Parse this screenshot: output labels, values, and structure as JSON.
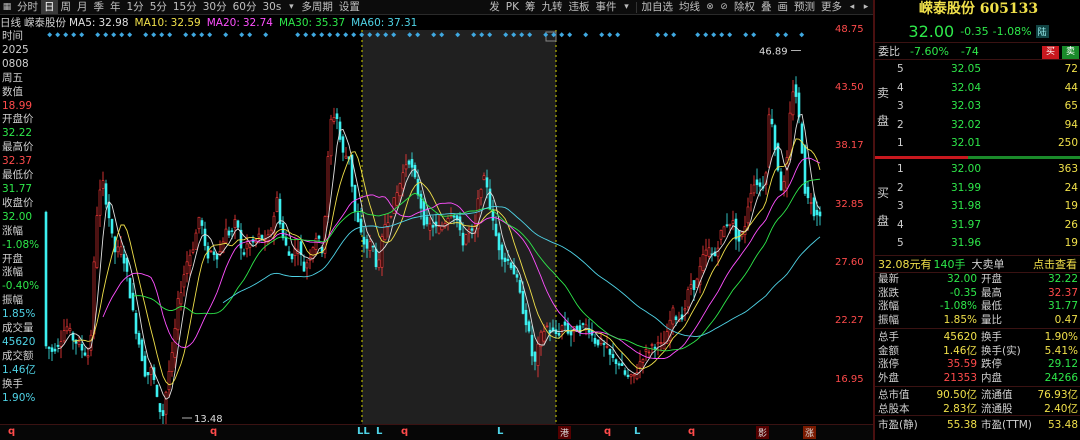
{
  "toolbar": {
    "left_items": [
      "分时",
      "日",
      "周",
      "月",
      "季",
      "年",
      "1分",
      "5分",
      "15分",
      "30分",
      "60分",
      "30s",
      "多周期",
      "设置"
    ],
    "active": "日",
    "right_items": [
      "发",
      "PK",
      "筹",
      "九转",
      "违板",
      "事件",
      "加自选",
      "均线",
      "除权",
      "叠",
      "画",
      "预测",
      "更多"
    ]
  },
  "ma_line": {
    "period": "日线",
    "stock": "嵘泰股份",
    "ma5": {
      "label": "MA5:",
      "value": "32.98",
      "color": "#e0e0e0"
    },
    "ma10": {
      "label": "MA10:",
      "value": "32.59",
      "color": "#f0e04a"
    },
    "ma20": {
      "label": "MA20:",
      "value": "32.74",
      "color": "#ff50ff"
    },
    "ma30": {
      "label": "MA30:",
      "value": "35.37",
      "color": "#2ee84a"
    },
    "ma60": {
      "label": "MA60:",
      "value": "37.31",
      "color": "#4fd3e6"
    }
  },
  "info": {
    "time_label": "时间",
    "year": "2025",
    "date": "0808",
    "weekday": "周五",
    "value_label": "数值",
    "value": "18.99",
    "open_label": "开盘价",
    "open": "32.22",
    "high_label": "最高价",
    "high": "32.37",
    "low_label": "最低价",
    "low": "31.77",
    "close_label": "收盘价",
    "close": "32.00",
    "chg_label": "涨幅",
    "chg": "-1.08%",
    "open_chg_label1": "开盘",
    "open_chg_label2": "涨幅",
    "open_chg": "-0.40%",
    "amp_label": "振幅",
    "amp": "1.85%",
    "vol_label": "成交量",
    "vol": "45620",
    "amt_label": "成交额",
    "amt": "1.46亿",
    "turn_label": "换手",
    "turn": "1.90%"
  },
  "axis": {
    "ticks": [
      "48.75",
      "43.50",
      "38.17",
      "32.85",
      "27.60",
      "22.27",
      "16.95"
    ],
    "high_marker": "46.89",
    "low_marker": "13.48"
  },
  "bottom_markers": {
    "q": "q",
    "l": "L",
    "b1": "LL",
    "hk": "港",
    "ying": "影",
    "zhang": "涨"
  },
  "panel": {
    "title": "嵘泰股份 605133",
    "price": "32.00",
    "change": "-0.35",
    "pct": "-1.08%",
    "tag": "陆",
    "wb_label": "委比",
    "wb_pct": "-7.60%",
    "wb_val": "-74",
    "buy_btn": "买",
    "sell_btn": "卖",
    "sell_label": [
      "卖",
      "盘"
    ],
    "buy_label": [
      "买",
      "盘"
    ],
    "asks": [
      {
        "level": "5",
        "price": "32.05",
        "vol": "72"
      },
      {
        "level": "4",
        "price": "32.04",
        "vol": "44"
      },
      {
        "level": "3",
        "price": "32.03",
        "vol": "65"
      },
      {
        "level": "2",
        "price": "32.02",
        "vol": "94"
      },
      {
        "level": "1",
        "price": "32.01",
        "vol": "250"
      }
    ],
    "bids": [
      {
        "level": "1",
        "price": "32.00",
        "vol": "363"
      },
      {
        "level": "2",
        "price": "31.99",
        "vol": "24"
      },
      {
        "level": "3",
        "price": "31.98",
        "vol": "19"
      },
      {
        "level": "4",
        "price": "31.97",
        "vol": "26"
      },
      {
        "level": "5",
        "price": "31.96",
        "vol": "19"
      }
    ],
    "big_order": {
      "price": "32.08元有",
      "qty": "140手",
      "label": "大卖单",
      "link": "点击查看"
    },
    "stats": [
      {
        "k1": "最新",
        "v1": "32.00",
        "c1": "#2ee84a",
        "k2": "开盘",
        "v2": "32.22",
        "c2": "#2ee84a"
      },
      {
        "k1": "涨跌",
        "v1": "-0.35",
        "c1": "#2ee84a",
        "k2": "最高",
        "v2": "32.37",
        "c2": "#ff4b4b"
      },
      {
        "k1": "涨幅",
        "v1": "-1.08%",
        "c1": "#2ee84a",
        "k2": "最低",
        "v2": "31.77",
        "c2": "#2ee84a"
      },
      {
        "k1": "振幅",
        "v1": "1.85%",
        "c1": "#f0e04a",
        "k2": "量比",
        "v2": "0.47",
        "c2": "#f0e04a"
      },
      {
        "k1": "总手",
        "v1": "45620",
        "c1": "#f0e04a",
        "k2": "换手",
        "v2": "1.90%",
        "c2": "#f0e04a"
      },
      {
        "k1": "金额",
        "v1": "1.46亿",
        "c1": "#f0e04a",
        "k2": "换手(实)",
        "v2": "5.41%",
        "c2": "#f0e04a"
      },
      {
        "k1": "涨停",
        "v1": "35.59",
        "c1": "#ff4b4b",
        "k2": "跌停",
        "v2": "29.12",
        "c2": "#2ee84a"
      },
      {
        "k1": "外盘",
        "v1": "21353",
        "c1": "#ff4b4b",
        "k2": "内盘",
        "v2": "24266",
        "c2": "#2ee84a"
      },
      {
        "k1": "总市值",
        "v1": "90.50亿",
        "c1": "#f0e04a",
        "k2": "流通值",
        "v2": "76.93亿",
        "c2": "#f0e04a"
      },
      {
        "k1": "总股本",
        "v1": "2.83亿",
        "c1": "#f0e04a",
        "k2": "流通股",
        "v2": "2.40亿",
        "c2": "#f0e04a"
      },
      {
        "k1": "市盈(静)",
        "v1": "55.38",
        "c1": "#f0e04a",
        "k2": "市盈(TTM)",
        "v2": "53.48",
        "c2": "#f0e04a"
      }
    ]
  },
  "chart_data": {
    "type": "candlestick",
    "ylim": [
      13.48,
      48.75
    ],
    "y_ticks": [
      48.75,
      43.5,
      38.17,
      32.85,
      27.6,
      22.27,
      16.95
    ],
    "trend": [
      [
        0,
        20.1
      ],
      [
        8,
        19.6
      ],
      [
        15,
        20.4
      ],
      [
        22,
        21.9
      ],
      [
        28,
        20.8
      ],
      [
        34,
        20.2
      ],
      [
        40,
        19.5
      ],
      [
        46,
        19.1
      ],
      [
        52,
        31.5
      ],
      [
        58,
        35.2
      ],
      [
        64,
        32.4
      ],
      [
        70,
        28.6
      ],
      [
        78,
        28.8
      ],
      [
        84,
        26.0
      ],
      [
        90,
        22.4
      ],
      [
        96,
        19.9
      ],
      [
        102,
        17.2
      ],
      [
        108,
        18.0
      ],
      [
        114,
        14.5
      ],
      [
        119,
        13.8
      ],
      [
        124,
        17.3
      ],
      [
        128,
        19.0
      ],
      [
        134,
        23.9
      ],
      [
        142,
        27.5
      ],
      [
        150,
        29.3
      ],
      [
        156,
        32.2
      ],
      [
        162,
        28.1
      ],
      [
        168,
        28.7
      ],
      [
        175,
        28.2
      ],
      [
        181,
        30.5
      ],
      [
        187,
        30.2
      ],
      [
        193,
        31.6
      ],
      [
        198,
        28.0
      ],
      [
        203,
        29.2
      ],
      [
        210,
        29.4
      ],
      [
        216,
        30.1
      ],
      [
        222,
        29.2
      ],
      [
        228,
        31.0
      ],
      [
        233,
        33.4
      ],
      [
        238,
        30.1
      ],
      [
        246,
        28.0
      ],
      [
        254,
        29.2
      ],
      [
        260,
        27.0
      ],
      [
        266,
        28.4
      ],
      [
        272,
        30.0
      ],
      [
        279,
        28.6
      ],
      [
        286,
        40.3
      ],
      [
        292,
        41.4
      ],
      [
        298,
        37.5
      ],
      [
        305,
        37.2
      ],
      [
        311,
        32.2
      ],
      [
        317,
        30.1
      ],
      [
        322,
        28.9
      ],
      [
        328,
        29.4
      ],
      [
        334,
        26.7
      ],
      [
        340,
        31.0
      ],
      [
        346,
        32.0
      ],
      [
        352,
        33.6
      ],
      [
        358,
        35.4
      ],
      [
        364,
        37.3
      ],
      [
        370,
        35.4
      ],
      [
        376,
        33.2
      ],
      [
        382,
        30.6
      ],
      [
        388,
        31.1
      ],
      [
        394,
        30.5
      ],
      [
        400,
        31.2
      ],
      [
        406,
        32.3
      ],
      [
        412,
        31.9
      ],
      [
        418,
        29.3
      ],
      [
        424,
        30.6
      ],
      [
        430,
        30.0
      ],
      [
        436,
        34.6
      ],
      [
        442,
        35.3
      ],
      [
        448,
        31.5
      ],
      [
        454,
        29.3
      ],
      [
        460,
        27.9
      ],
      [
        466,
        27.7
      ],
      [
        472,
        26.3
      ],
      [
        478,
        23.7
      ],
      [
        484,
        21.6
      ],
      [
        490,
        18.0
      ],
      [
        496,
        20.7
      ],
      [
        502,
        21.9
      ],
      [
        508,
        21.2
      ],
      [
        514,
        21.1
      ],
      [
        520,
        22.2
      ],
      [
        526,
        21.0
      ],
      [
        532,
        21.6
      ],
      [
        538,
        21.7
      ],
      [
        544,
        21.9
      ],
      [
        550,
        20.5
      ],
      [
        556,
        20.4
      ],
      [
        562,
        19.7
      ],
      [
        568,
        18.8
      ],
      [
        574,
        18.6
      ],
      [
        580,
        17.5
      ],
      [
        586,
        16.9
      ],
      [
        592,
        17.6
      ],
      [
        598,
        19.1
      ],
      [
        604,
        19.6
      ],
      [
        610,
        20.3
      ],
      [
        616,
        19.9
      ],
      [
        622,
        20.5
      ],
      [
        628,
        23.2
      ],
      [
        634,
        22.4
      ],
      [
        640,
        23.1
      ],
      [
        646,
        25.7
      ],
      [
        652,
        25.5
      ],
      [
        658,
        27.8
      ],
      [
        664,
        28.9
      ],
      [
        670,
        27.9
      ],
      [
        676,
        30.1
      ],
      [
        682,
        31.1
      ],
      [
        688,
        31.5
      ],
      [
        694,
        29.4
      ],
      [
        700,
        30.5
      ],
      [
        706,
        34.1
      ],
      [
        712,
        35.1
      ],
      [
        718,
        34.2
      ],
      [
        722,
        36.2
      ],
      [
        726,
        42.4
      ],
      [
        730,
        38.6
      ],
      [
        734,
        36.2
      ],
      [
        738,
        33.9
      ],
      [
        742,
        35.4
      ],
      [
        746,
        40.9
      ],
      [
        750,
        44.2
      ],
      [
        754,
        41.5
      ],
      [
        758,
        37.9
      ],
      [
        762,
        33.0
      ],
      [
        766,
        33.7
      ],
      [
        770,
        32.3
      ],
      [
        774,
        32.2
      ]
    ]
  }
}
